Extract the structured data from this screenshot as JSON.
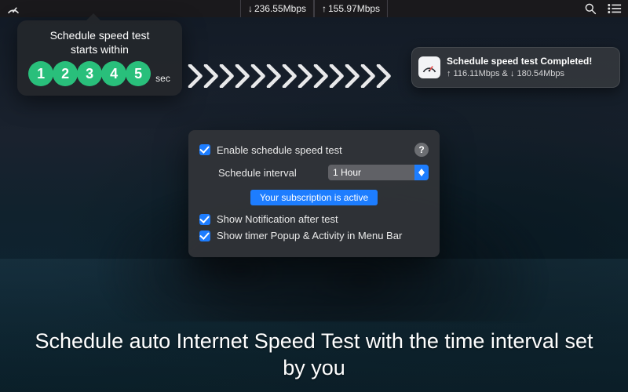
{
  "menubar": {
    "download_arrow": "↓",
    "download_speed": "236.55Mbps",
    "upload_arrow": "↑",
    "upload_speed": "155.97Mbps"
  },
  "popup": {
    "line1": "Schedule speed test",
    "line2": "starts within",
    "digits": [
      "1",
      "2",
      "3",
      "4",
      "5"
    ],
    "sec_label": "sec"
  },
  "notification": {
    "title": "Schedule speed test Completed!",
    "subtitle": "↑ 116.11Mbps & ↓ 180.54Mbps"
  },
  "settings": {
    "enable_label": "Enable schedule speed test",
    "help": "?",
    "interval_label": "Schedule interval",
    "interval_value": "1 Hour",
    "subscription": "Your subscription is active",
    "show_notification_label": "Show Notification after test",
    "show_timer_label": "Show timer Popup & Activity in Menu Bar"
  },
  "caption": "Schedule auto Internet Speed Test with the time interval set by you"
}
